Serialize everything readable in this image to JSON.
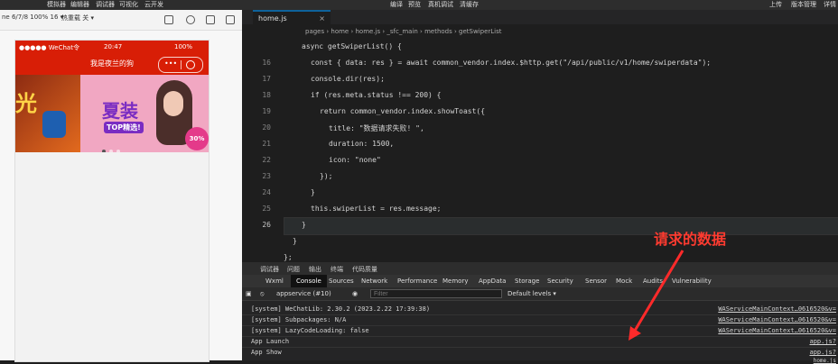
{
  "top_menu": {
    "left": [
      "模拟器",
      "编辑器",
      "调试器",
      "可视化",
      "云开发"
    ],
    "center": [
      "编译",
      "预览",
      "真机调试",
      "清缓存"
    ],
    "right": [
      "上传",
      "版本管理",
      "详情"
    ]
  },
  "simulator_bar": {
    "device": "ne 6/7/8 100% 16 ▾",
    "hot_reload": "热重载 关 ▾"
  },
  "phone": {
    "status_left": "●●●●● WeChat令",
    "time": "20:47",
    "battery": "100%",
    "title": "我是夜兰的狗",
    "banner": {
      "left_text": "光",
      "promo_main": "夏装",
      "promo_top": "TOP精选!",
      "badge": "30% OFF"
    }
  },
  "editor": {
    "tab": "home.js",
    "breadcrumb": "pages › home › home.js › _sfc_main › methods › getSwiperList",
    "lines": [
      {
        "n": "",
        "t": "async getSwiperList() {"
      },
      {
        "n": "16",
        "t": "const { data: res } = await common_vendor.index.$http.get(\"/api/public/v1/home/swiperdata\");"
      },
      {
        "n": "17",
        "t": "console.dir(res);"
      },
      {
        "n": "18",
        "t": "if (res.meta.status !== 200) {"
      },
      {
        "n": "19",
        "t": "return common_vendor.index.showToast({"
      },
      {
        "n": "20",
        "t": "title: \"数据请求失败! \","
      },
      {
        "n": "21",
        "t": "duration: 1500,"
      },
      {
        "n": "22",
        "t": "icon: \"none\""
      },
      {
        "n": "23",
        "t": "});"
      },
      {
        "n": "24",
        "t": "}"
      },
      {
        "n": "25",
        "t": "this.swiperList = res.message;"
      },
      {
        "n": "26",
        "t": "}"
      },
      {
        "n": "",
        "t": "}"
      },
      {
        "n": "",
        "t": "};"
      }
    ],
    "annotation": "请求的数据"
  },
  "devtools": {
    "top_tabs": [
      "调试器",
      "问题",
      "输出",
      "终端",
      "代码质量"
    ],
    "tabs": [
      "Wxml",
      "Console",
      "Sources",
      "Network",
      "Performance",
      "Memory",
      "AppData",
      "Storage",
      "Security",
      "Sensor",
      "Mock",
      "Audits",
      "Vulnerability"
    ],
    "context": "appservice (#10)",
    "filter_placeholder": "Filter",
    "levels": "Default levels ▾",
    "logs": [
      {
        "text": "[system] WeChatLib: 2.30.2 (2023.2.22 17:39:38)",
        "link": "WAServiceMainContext…0616520&v="
      },
      {
        "text": "[system] Subpackages: N/A",
        "link": "WAServiceMainContext…0616520&v="
      },
      {
        "text": "[system] LazyCodeLoading: false",
        "link": "WAServiceMainContext…0616520&v="
      },
      {
        "text": "App Launch",
        "link": "app.js?"
      },
      {
        "text": "App Show",
        "link": "app.js?"
      }
    ],
    "last_link": "home.js"
  }
}
